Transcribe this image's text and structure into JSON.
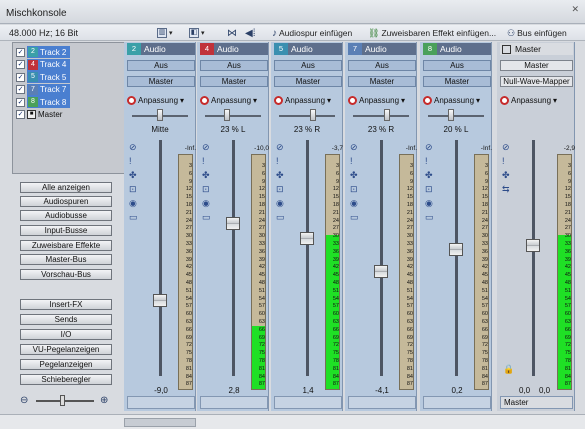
{
  "window": {
    "title": "Mischkonsole"
  },
  "toolbar": {
    "format": "48.000 Hz; 16 Bit",
    "add_audio_track": "Audiospur einfügen",
    "add_assignable_fx": "Zuweisbaren Effekt einfügen...",
    "add_bus": "Bus einfügen"
  },
  "track_list": [
    {
      "num": "2",
      "label": "Track 2",
      "color": "#3aa0a8"
    },
    {
      "num": "4",
      "label": "Track 4",
      "color": "#c0323a"
    },
    {
      "num": "5",
      "label": "Track 5",
      "color": "#3a8fb0"
    },
    {
      "num": "7",
      "label": "Track 7",
      "color": "#5a7fb5"
    },
    {
      "num": "8",
      "label": "Track 8",
      "color": "#4aa05a"
    },
    {
      "num": "",
      "label": "Master",
      "color": ""
    }
  ],
  "sidebar_buttons": [
    "Alle anzeigen",
    "Audiospuren",
    "Audiobusse",
    "Input-Busse",
    "Zuweisbare Effekte",
    "Master-Bus",
    "Vorschau-Bus",
    "Insert-FX",
    "Sends",
    "I/O",
    "VU-Pegelanzeigen",
    "Pegelanzeigen",
    "Schieberegler"
  ],
  "strips": [
    {
      "num": "2",
      "name": "Audio",
      "color": "#3aa0a8",
      "btn1": "Aus",
      "btn2": "Master",
      "fx": "Anpassung",
      "pan": "Mitte",
      "peak": "-Inf.",
      "fader_value": "-9,0",
      "fader_level": 0.3,
      "meter_level": 0.0
    },
    {
      "num": "4",
      "name": "Audio",
      "color": "#c0323a",
      "btn1": "Aus",
      "btn2": "Master",
      "fx": "Anpassung",
      "pan": "23 % L",
      "peak": "-10,0",
      "fader_value": "2,8",
      "fader_level": 0.65,
      "meter_level": 0.27
    },
    {
      "num": "5",
      "name": "Audio",
      "color": "#3a8fb0",
      "btn1": "Aus",
      "btn2": "Master",
      "fx": "Anpassung",
      "pan": "23 % R",
      "peak": "-3,7",
      "fader_value": "1,4",
      "fader_level": 0.58,
      "meter_level": 0.66
    },
    {
      "num": "7",
      "name": "Audio",
      "color": "#5a7fb5",
      "btn1": "Aus",
      "btn2": "Master",
      "fx": "Anpassung",
      "pan": "23 % R",
      "peak": "-Inf.",
      "fader_value": "-4,1",
      "fader_level": 0.43,
      "meter_level": 0.0
    },
    {
      "num": "8",
      "name": "Audio",
      "color": "#4aa05a",
      "btn1": "Aus",
      "btn2": "Master",
      "fx": "Anpassung",
      "pan": "20 % L",
      "peak": "-Inf.",
      "fader_value": "0,2",
      "fader_level": 0.53,
      "meter_level": 0.0
    }
  ],
  "master": {
    "name": "Master",
    "btn1": "Master",
    "btn2": "Null-Wave-Mapper",
    "fx": "Anpassung",
    "peak": "-2,9",
    "values": [
      "0,0",
      "0,0"
    ],
    "meter_level": 0.66,
    "fader_level": 0.55,
    "bottom": "Master"
  },
  "meter_scale": [
    "3",
    "6",
    "9",
    "12",
    "15",
    "18",
    "21",
    "24",
    "27",
    "30",
    "33",
    "36",
    "39",
    "42",
    "45",
    "48",
    "51",
    "54",
    "57",
    "60",
    "63",
    "66",
    "69",
    "72",
    "75",
    "78",
    "81",
    "84",
    "87"
  ]
}
